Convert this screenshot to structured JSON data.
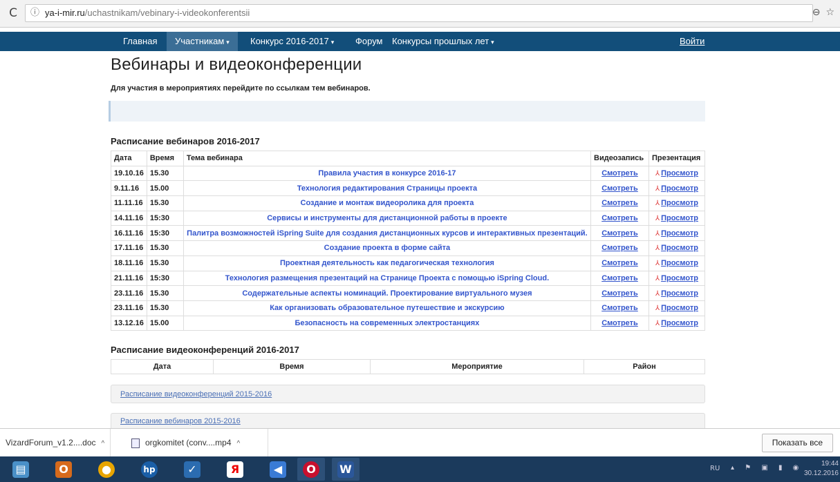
{
  "browser": {
    "url_host": "ya-i-mir.ru",
    "url_path": "/uchastnikam/vebinary-i-videokonferentsii",
    "reload_icon": "reload-icon",
    "info_icon": "info-icon"
  },
  "nav": {
    "items": [
      {
        "label": "Главная",
        "dropdown": false
      },
      {
        "label": "Участникам",
        "dropdown": true,
        "active": true
      },
      {
        "label": "Конкурс 2016-2017",
        "dropdown": true
      },
      {
        "label": "Форум",
        "dropdown": false
      },
      {
        "label": "Конкурсы прошлых лет",
        "dropdown": true
      }
    ],
    "login": "Войти"
  },
  "page": {
    "title": "Вебинары и видеоконференции",
    "lead": "Для участия в мероприятиях перейдите по ссылкам тем вебинаров."
  },
  "webinars": {
    "heading": "Расписание вебинаров 2016-2017",
    "columns": {
      "date": "Дата",
      "time": "Время",
      "topic": "Тема вебинара",
      "video": "Видеозапись",
      "presentation": "Презентация"
    },
    "rows": [
      {
        "date": "19.10.16",
        "time": "15.30",
        "topic": "Правила участия в конкурсе 2016-17",
        "video": "Смотреть",
        "pres": "Просмотр"
      },
      {
        "date": "9.11.16",
        "time": "15.00",
        "topic": "Технология редактирования Страницы проекта",
        "video": "Смотреть",
        "pres": "Просмотр"
      },
      {
        "date": "11.11.16",
        "time": "15.30",
        "topic": "Создание и монтаж видеоролика для проекта",
        "video": "Смотреть",
        "pres": "Просмотр"
      },
      {
        "date": "14.11.16",
        "time": "15:30",
        "topic": "Сервисы и инструменты для дистанционной работы в проекте",
        "video": "Смотреть",
        "pres": "Просмотр"
      },
      {
        "date": "16.11.16",
        "time": "15:30",
        "topic": "Палитра возможностей iSpring Suite для создания дистанционных курсов и интерактивных презентаций.",
        "video": "Смотреть",
        "pres": "Просмотр"
      },
      {
        "date": "17.11.16",
        "time": "15.30",
        "topic": "Создание проекта в форме сайта",
        "video": "Смотреть",
        "pres": "Просмотр"
      },
      {
        "date": "18.11.16",
        "time": "15.30",
        "topic": "Проектная деятельность как педагогическая технология",
        "video": "Смотреть",
        "pres": "Просмотр"
      },
      {
        "date": "21.11.16",
        "time": "15:30",
        "topic": "Технология размещения презентаций на Странице Проекта с помощью iSpring Cloud.",
        "video": "Смотреть",
        "pres": "Просмотр"
      },
      {
        "date": "23.11.16",
        "time": "15.30",
        "topic": "Содержательные аспекты номинаций. Проектирование виртуального музея",
        "video": "Смотреть",
        "pres": "Просмотр"
      },
      {
        "date": "23.11.16",
        "time": "15.30",
        "topic": "Как организовать образовательное путешествие и экскурсию",
        "video": "Смотреть",
        "pres": "Просмотр"
      },
      {
        "date": "13.12.16",
        "time": "15.00",
        "topic": "Безопасность на современных электростанциях",
        "video": "Смотреть",
        "pres": "Просмотр"
      }
    ]
  },
  "videoconf": {
    "heading": "Расписание видеоконференций 2016-2017",
    "columns": [
      "Дата",
      "Время",
      "Мероприятие",
      "Район"
    ]
  },
  "panels": {
    "vc_2015": "Расписание видеоконференций 2015-2016",
    "web_2015": "Расписание вебинаров 2015-2016"
  },
  "downloads": {
    "item1": "VizardForum_v1.2....doc",
    "item2": "orgkomitet (conv....mp4",
    "show_all": "Показать все"
  },
  "taskbar": {
    "lang": "RU",
    "time": "19:44",
    "date": "30.12.2016"
  }
}
